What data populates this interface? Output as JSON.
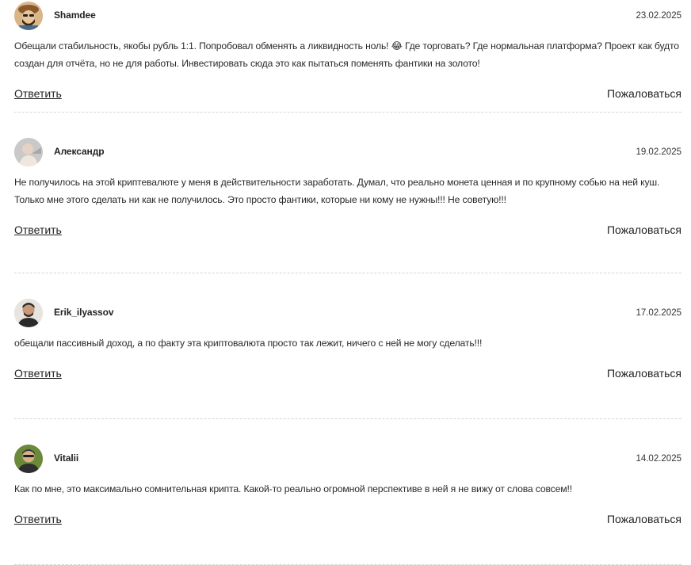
{
  "comments": [
    {
      "author": "Shamdee",
      "date": "23.02.2025",
      "text": "Обещали стабильность, якобы рубль 1:1. Попробовал обменять а ликвидность ноль! 😂 Где торговать? Где нормальная платформа? Проект как будто создан для отчёта, но не для работы. Инвестировать сюда это как пытаться поменять фантики на золото!",
      "reply_label": "Ответить",
      "report_label": "Пожаловаться"
    },
    {
      "author": "Александр",
      "date": "19.02.2025",
      "text": "Не получилось на этой криптевалюте у меня в действительности заработать. Думал, что реально монета ценная и по крупному собью на ней куш. Только мне этого сделать ни как не получилось. Это просто фантики, которые ни кому не нужны!!! Не советую!!!",
      "reply_label": "Ответить",
      "report_label": "Пожаловаться"
    },
    {
      "author": "Erik_ilyassov",
      "date": "17.02.2025",
      "text": "обещали пассивный доход, а по факту эта криптовалюта просто так лежит, ничего с ней не могу сделать!!!",
      "reply_label": "Ответить",
      "report_label": "Пожаловаться"
    },
    {
      "author": "Vitalii",
      "date": "14.02.2025",
      "text": "Как по мне, это максимально сомнительная крипта. Какой-то реально огромной перспективе в ней я не вижу от слова совсем!!",
      "reply_label": "Ответить",
      "report_label": "Пожаловаться"
    }
  ]
}
